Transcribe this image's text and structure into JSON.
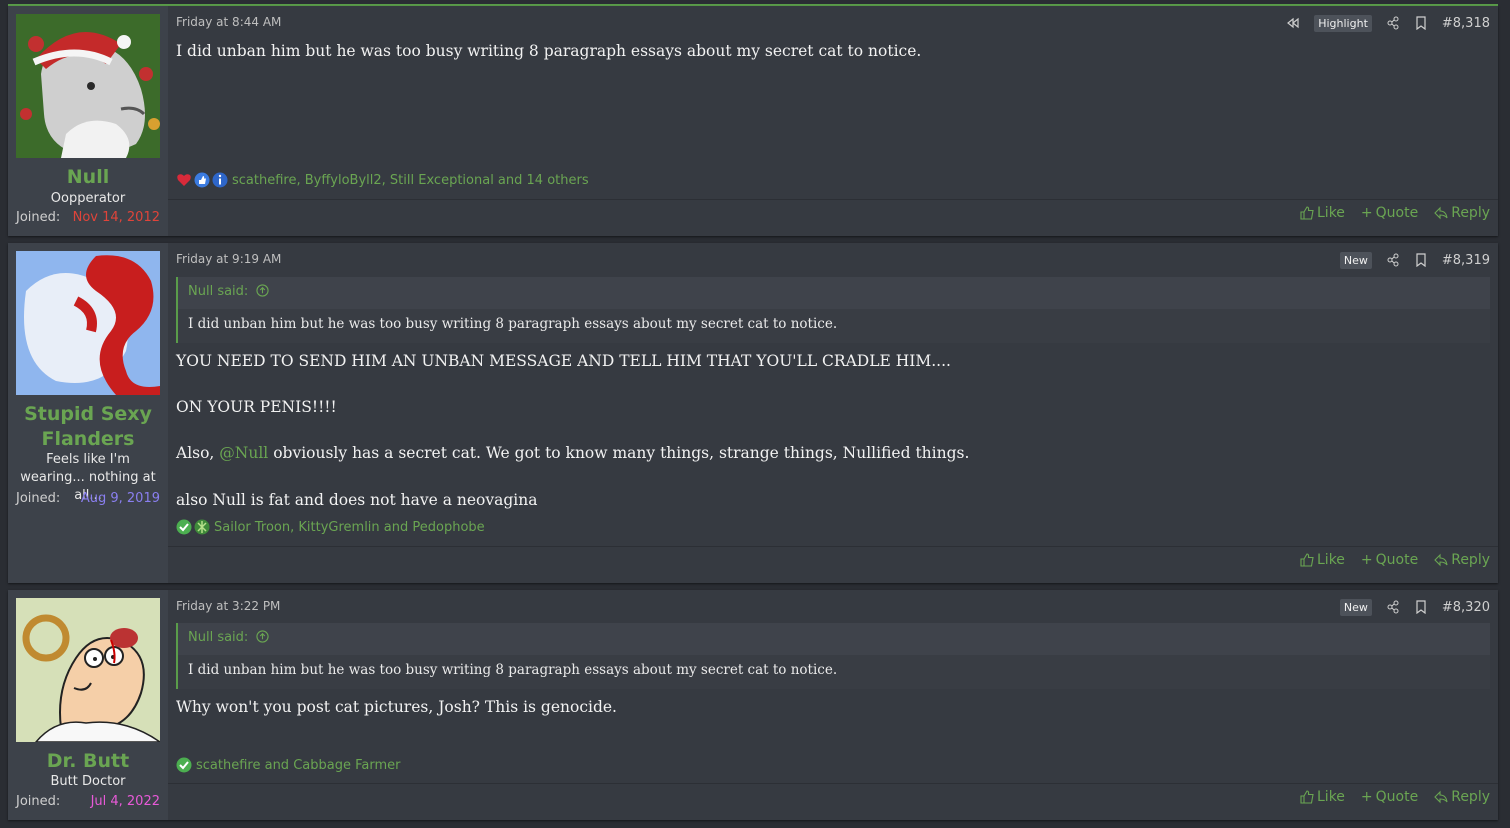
{
  "posts": [
    {
      "user": {
        "name": "Null",
        "title": "Oopperator",
        "joined_label": "Joined:",
        "joined_date": "Nov 14, 2012",
        "joined_color": "#e0443a"
      },
      "date": "Friday at 8:44 AM",
      "badge": "Highlight",
      "number": "#8,318",
      "body": [
        "I did unban him but he was too busy writing 8 paragraph essays about my secret cat to notice."
      ],
      "reactions": "scathefire, ByffyloByll2, Still Exceptional and 14 others"
    },
    {
      "user": {
        "name": "Stupid Sexy Flanders",
        "title": "Feels like I'm wearing... nothing at all...",
        "joined_label": "Joined:",
        "joined_date": "Aug 9, 2019",
        "joined_color": "#8a7ff0"
      },
      "date": "Friday at 9:19 AM",
      "badge": "New",
      "number": "#8,319",
      "quote": {
        "author": "Null said:",
        "text": "I did unban him but he was too busy writing 8 paragraph essays about my secret cat to notice."
      },
      "body": [
        "YOU NEED TO SEND HIM AN UNBAN MESSAGE AND TELL HIM THAT YOU'LL CRADLE HIM....",
        "ON YOUR PENIS!!!!",
        "Also, ",
        "@Null",
        " obviously has a secret cat. We got to know many things, strange things, Nullified things.",
        "also Null is fat and does not have a neovagina"
      ],
      "reactions": "Sailor Troon, KittyGremlin and Pedophobe"
    },
    {
      "user": {
        "name": "Dr. Butt",
        "title": "Butt Doctor",
        "joined_label": "Joined:",
        "joined_date": "Jul 4, 2022",
        "joined_color": "#e85ad8"
      },
      "date": "Friday at 3:22 PM",
      "badge": "New",
      "number": "#8,320",
      "quote": {
        "author": "Null said:",
        "text": "I did unban him but he was too busy writing 8 paragraph essays about my secret cat to notice."
      },
      "body": [
        "Why won't you post cat pictures, Josh? This is genocide."
      ],
      "reactions": "scathefire and Cabbage Farmer"
    }
  ],
  "actions": {
    "like": "Like",
    "quote": "Quote",
    "reply": "Reply"
  },
  "icons": [
    "rewind-icon",
    "share-icon",
    "bookmark-icon",
    "like-icon",
    "plus-icon",
    "reply-icon",
    "heart-icon",
    "thumbsup-icon",
    "info-icon",
    "check-icon",
    "arrow-up-circle-icon"
  ],
  "colors": {
    "accent": "#6aa552",
    "post_bg": "#363a41",
    "userpane_bg": "#3d424a"
  }
}
